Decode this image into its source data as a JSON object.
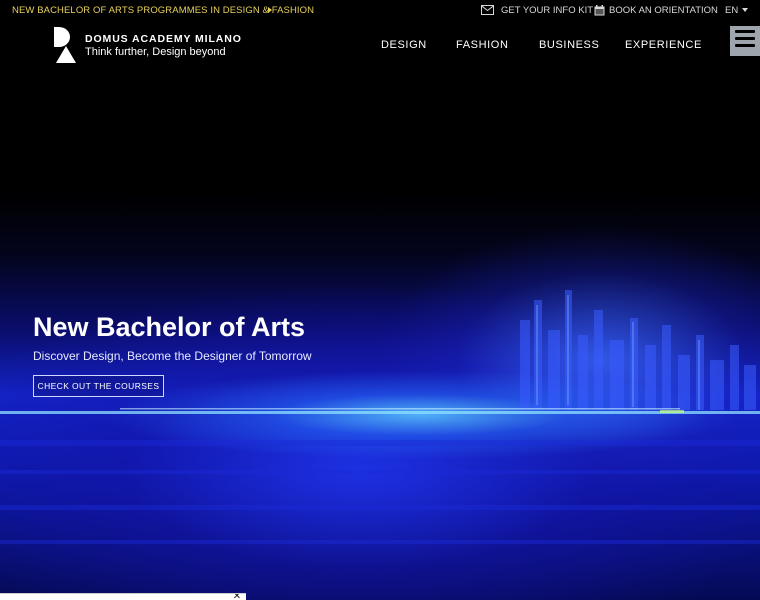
{
  "topbar": {
    "announcement": "NEW BACHELOR OF ARTS PROGRAMMES IN DESIGN & FASHION",
    "info_kit": "GET YOUR INFO KIT",
    "orientation": "BOOK AN ORIENTATION",
    "language": "EN"
  },
  "brand": {
    "name": "DOMUS ACADEMY MILANO",
    "tagline": "Think further, Design beyond"
  },
  "nav": {
    "items": [
      "DESIGN",
      "FASHION",
      "BUSINESS",
      "EXPERIENCE"
    ]
  },
  "hero": {
    "title": "New Bachelor of Arts",
    "subtitle": "Discover Design, Become the Designer of Tomorrow",
    "cta": "CHECK OUT THE COURSES"
  },
  "popup": {
    "close_glyph": "✕"
  },
  "colors": {
    "announcement": "#e8d15a",
    "menu_button": "#9ea5ad",
    "hero_blue": "#1424c8"
  },
  "icons": {
    "info_kit": "envelope-icon",
    "orientation": "calendar-icon",
    "language": "caret-down-icon",
    "menu": "hamburger-icon"
  }
}
